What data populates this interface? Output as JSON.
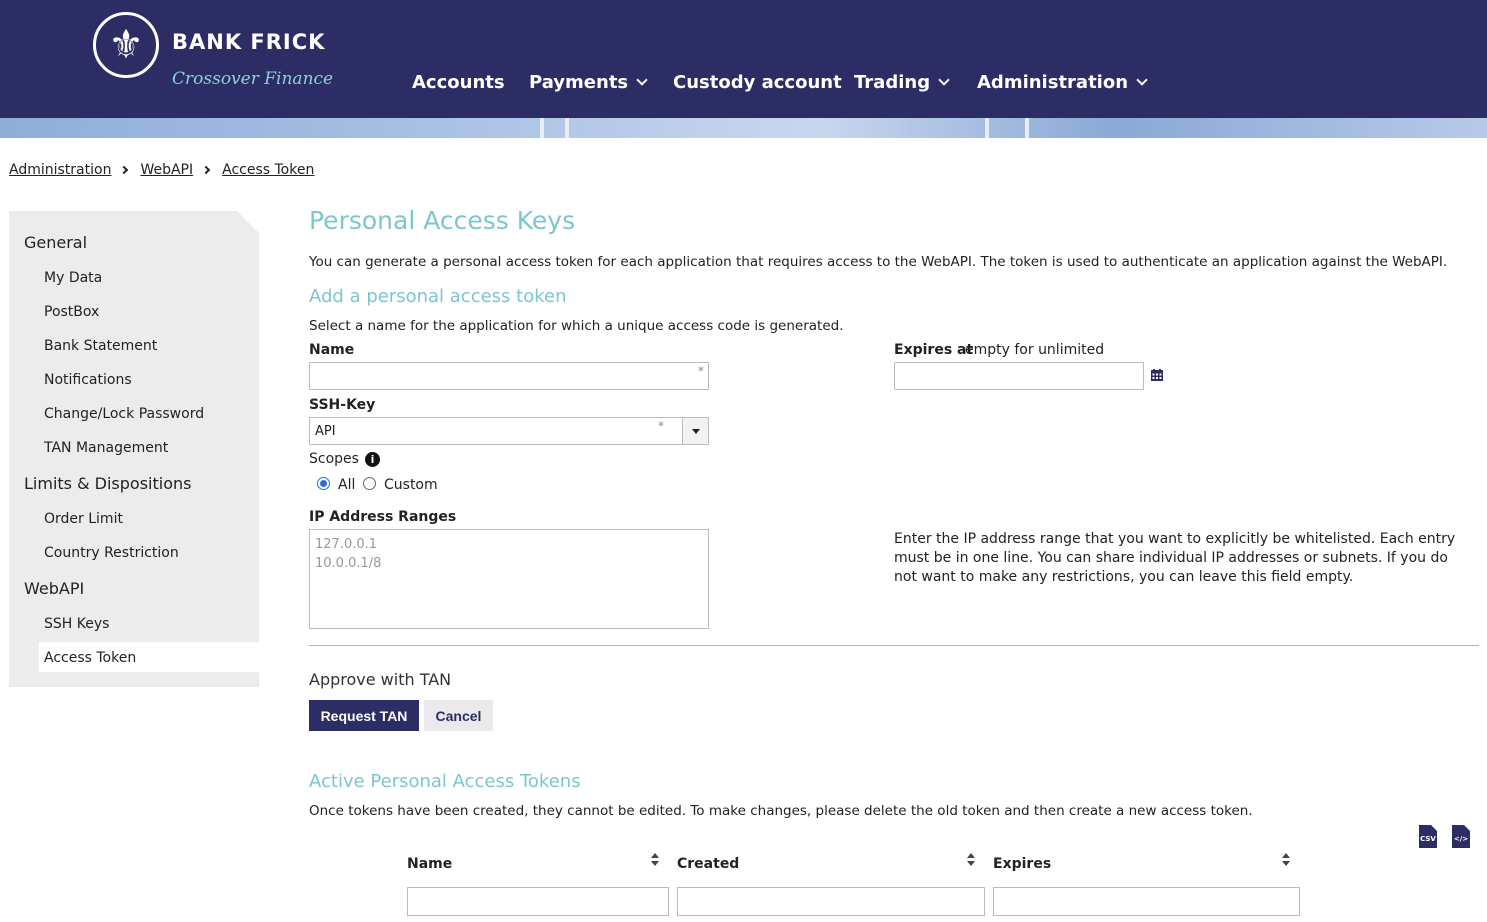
{
  "brand": {
    "name": "BANK FRICK",
    "tagline": "Crossover Finance",
    "color": "#2b2d64",
    "accent": "#7cc6ce"
  },
  "nav": {
    "accounts": "Accounts",
    "payments": "Payments",
    "custody": "Custody account",
    "trading": "Trading",
    "administration": "Administration"
  },
  "breadcrumb": [
    "Administration",
    "WebAPI",
    "Access Token"
  ],
  "sidebar": {
    "general": "General",
    "my_data": "My Data",
    "postbox": "PostBox",
    "bank_statement": "Bank Statement",
    "notifications": "Notifications",
    "change_password": "Change/Lock Password",
    "tan_management": "TAN Management",
    "limits": "Limits & Dispositions",
    "order_limit": "Order Limit",
    "country_restriction": "Country Restriction",
    "webapi": "WebAPI",
    "ssh_keys": "SSH Keys",
    "access_token": "Access Token"
  },
  "main": {
    "title": "Personal Access Keys",
    "intro": "You can generate a personal access token for each application that requires access to the WebAPI. The token is used to authenticate an application against the WebAPI.",
    "add_title": "Add a personal access token",
    "add_desc": "Select a name for the application for which a unique access code is generated.",
    "name_label": "Name",
    "name_value": "",
    "required_mark": "*",
    "expires_label": "Expires at",
    "expires_hint": "empty for unlimited",
    "ssh_label": "SSH-Key",
    "ssh_value": "API",
    "scopes_label": "Scopes",
    "scope_all": "All",
    "scope_custom": "Custom",
    "ip_label": "IP Address Ranges",
    "ip_placeholder_1": "127.0.0.1",
    "ip_placeholder_2": "10.0.0.1/8",
    "ip_help": "Enter the IP address range that you want to explicitly be whitelisted. Each entry must be in one line. You can share individual IP addresses or subnets. If you do not want to make any restrictions, you can leave this field empty.",
    "approve": "Approve with TAN",
    "request_tan": "Request TAN",
    "cancel": "Cancel",
    "active_title": "Active Personal Access Tokens",
    "active_desc": "Once tokens have been created, they cannot be edited. To make changes, please delete the old token and then create a new access token.",
    "export_csv": "CSV",
    "export_xml": "</>",
    "table_headers": {
      "name": "Name",
      "created": "Created",
      "expires": "Expires"
    }
  }
}
